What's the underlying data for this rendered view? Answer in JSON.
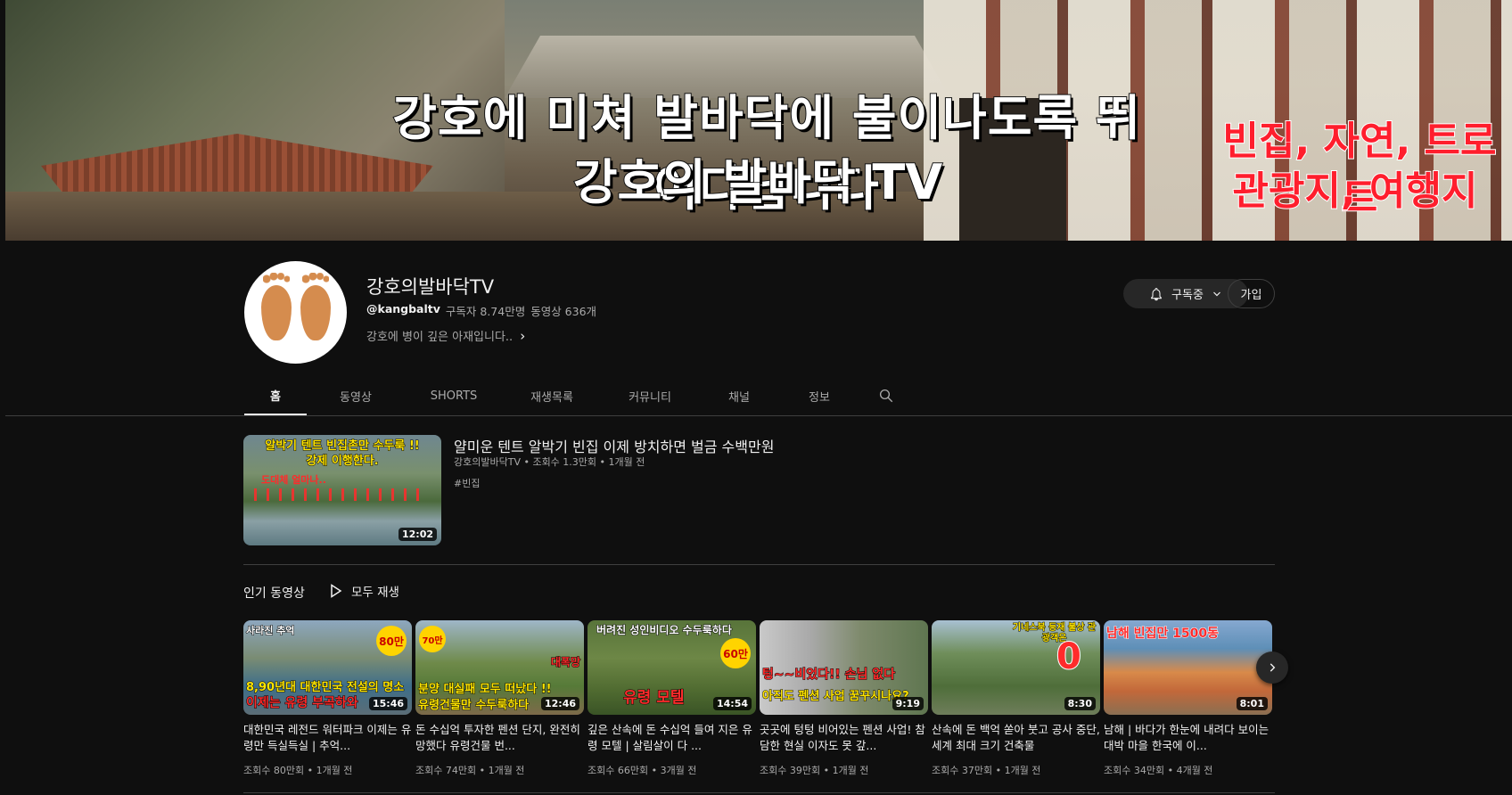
{
  "banner": {
    "line1": "강호에 미쳐 발바닥에 불이나도록 뛰어다닙니다",
    "line2": "강호의 발바닥 TV",
    "side1": "빈집, 자연, 트로트",
    "side2": "관광지, 여행지"
  },
  "channel": {
    "name": "강호의발바닥TV",
    "handle": "@kangbaltv",
    "subscribers": "구독자 8.74만명",
    "videos": "동영상 636개",
    "description": "강호에 병이 깊은 아재입니다..",
    "subscribed_label": "구독중",
    "join_label": "가입"
  },
  "tabs": [
    {
      "label": "홈"
    },
    {
      "label": "동영상"
    },
    {
      "label": "SHORTS"
    },
    {
      "label": "재생목록"
    },
    {
      "label": "커뮤니티"
    },
    {
      "label": "채널"
    },
    {
      "label": "정보"
    }
  ],
  "featured": {
    "title": "얄미운 텐트 알박기 빈집 이제 방치하면 벌금 수백만원",
    "meta": "강호의발바닥TV • 조회수 1.3만회 • 1개월 전",
    "tag": "#빈집",
    "duration": "12:02",
    "thumb_line1": "알박기 텐트 빈집촌만 수두룩 !!",
    "thumb_line2": "강제 이행한다.",
    "thumb_line3": "도대체 얼마나.."
  },
  "popular": {
    "title": "인기 동영상",
    "play_all": "모두 재생",
    "videos": [
      {
        "title": "대한민국 레전드 워터파크 이제는 유령만 득실득실 | 추억...",
        "meta": "조회수 80만회 • 1개월 전",
        "duration": "15:46",
        "cap_top": "사라진 추억",
        "cap_mid": "8,90년대 대한민국 전설의 명소",
        "cap_bot": "이제는 유령 부곡하와",
        "badge": "80만"
      },
      {
        "title": "돈 수십억 투자한 펜션 단지, 완전히 망했다 유령건물 번...",
        "meta": "조회수 74만회 • 1개월 전",
        "duration": "12:46",
        "cap_top": "70만",
        "cap_mid": "분양 대실패 모두 떠났다 !!",
        "cap_bot": "유령건물만 수두룩하다",
        "badge": "대폭망"
      },
      {
        "title": "깊은 산속에 돈 수십억 들여 지은 유령 모텔 | 살림살이 다 ...",
        "meta": "조회수 66만회 • 3개월 전",
        "duration": "14:54",
        "cap_top": "버려진 성인비디오 수두룩하다",
        "cap_mid": "",
        "cap_bot": "유령 모텔",
        "badge": "60만"
      },
      {
        "title": "곳곳에 텅텅 비어있는 펜션 사업! 참담한 현실 이자도 못 갚...",
        "meta": "조회수 39만회 • 1개월 전",
        "duration": "9:19",
        "cap_top": "",
        "cap_mid": "텅~~비었다!! 손님 없다",
        "cap_bot": "아직도 펜션 사업 꿈꾸시나요?",
        "badge": ""
      },
      {
        "title": "산속에 돈 백억 쏟아 붓고 공사 중단, 세계 최대 크기 건축물",
        "meta": "조회수 37만회 • 1개월 전",
        "duration": "8:30",
        "cap_top": "기네스북 등재 불상 관광객은",
        "cap_mid": "0",
        "cap_bot": "",
        "badge": ""
      },
      {
        "title": "남해 | 바다가 한눈에 내려다 보이는 대박 마을 한국에 이...",
        "meta": "조회수 34만회 • 4개월 전",
        "duration": "8:01",
        "cap_top": "남해 빈집만 1500동",
        "cap_mid": "",
        "cap_bot": "",
        "badge": ""
      }
    ]
  }
}
